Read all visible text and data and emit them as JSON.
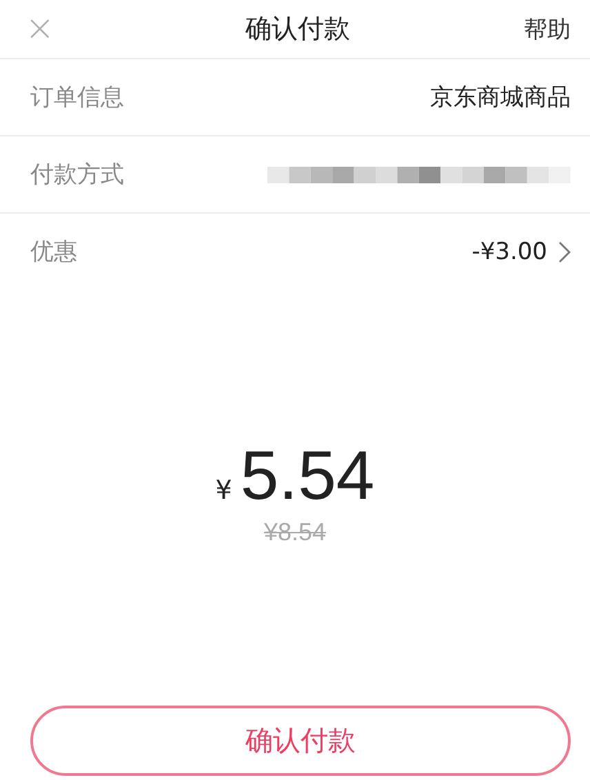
{
  "header": {
    "close": "×",
    "title": "确认付款",
    "help": "帮助"
  },
  "rows": [
    {
      "kind": "text",
      "label": "订单信息",
      "value": "京东商城商品"
    },
    {
      "kind": "masked",
      "label": "付款方式"
    },
    {
      "kind": "link",
      "label": "优惠",
      "value": "-¥3.00"
    }
  ],
  "amount": {
    "currency": "¥",
    "value": "5.54",
    "original": "¥8.54"
  },
  "button": "确认付款"
}
